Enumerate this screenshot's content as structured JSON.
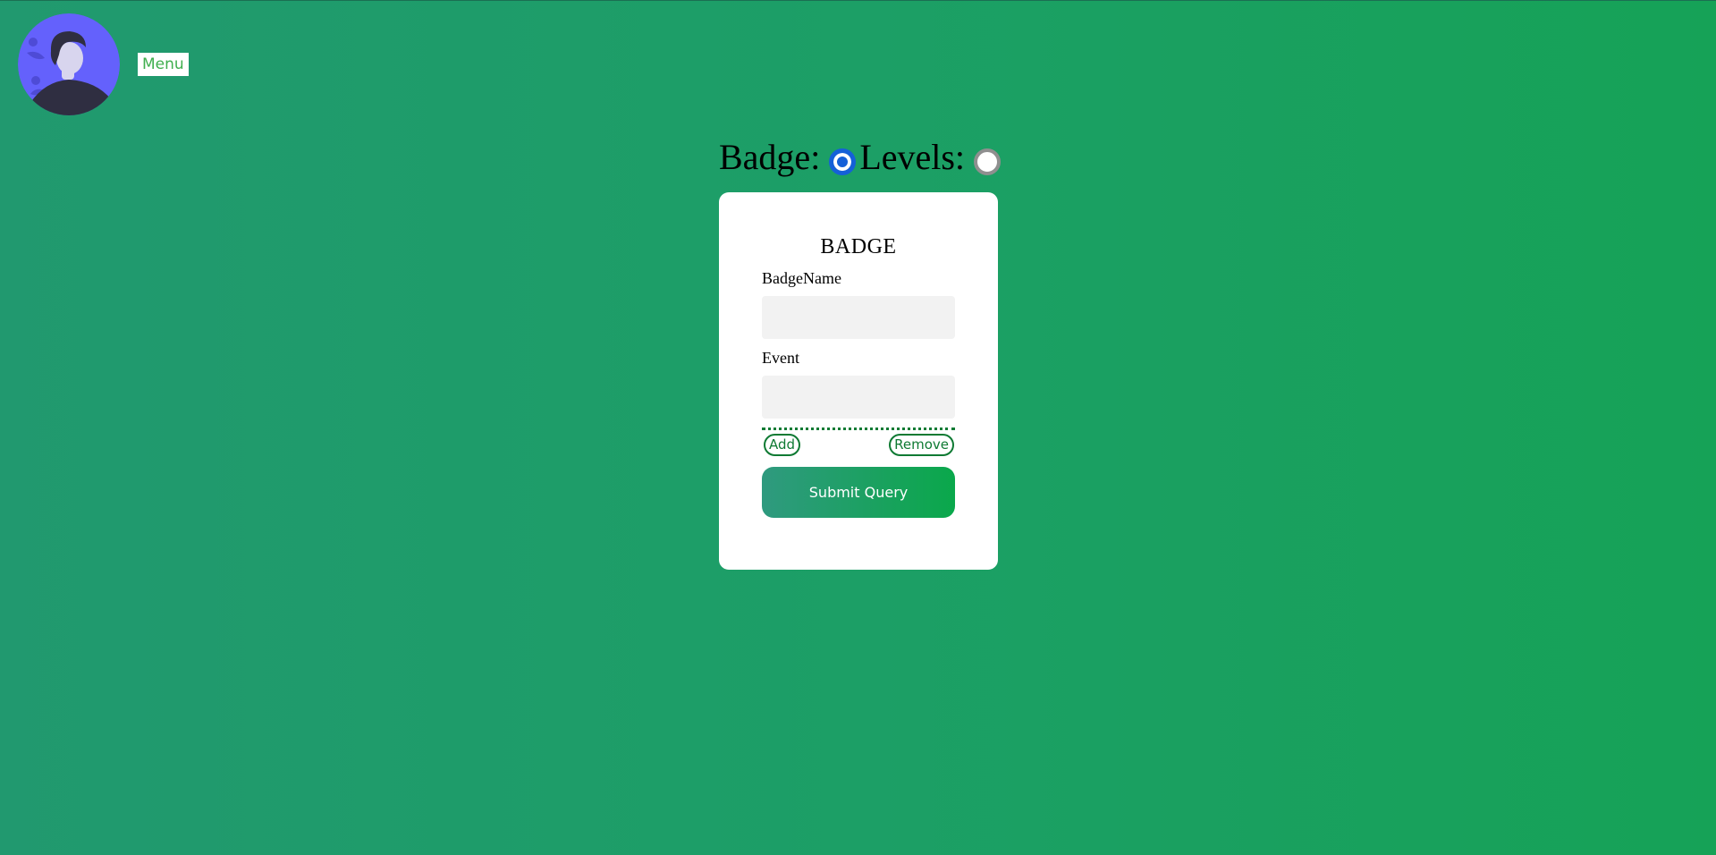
{
  "header": {
    "avatar_icon": "user-avatar-icon",
    "menu_label": "Menu"
  },
  "mode_toggle": {
    "badge_label": "Badge:",
    "levels_label": "Levels:",
    "selected": "badge"
  },
  "form": {
    "title": "BADGE",
    "badge_name_label": "BadgeName",
    "badge_name_value": "",
    "event_label": "Event",
    "event_value": "",
    "add_label": "Add",
    "remove_label": "Remove",
    "submit_label": "Submit Query"
  },
  "colors": {
    "background_start": "#21996f",
    "background_end": "#16a257",
    "accent_green": "#0f7a33",
    "radio_checked": "#1560d8",
    "avatar_bg": "#6461fc"
  }
}
